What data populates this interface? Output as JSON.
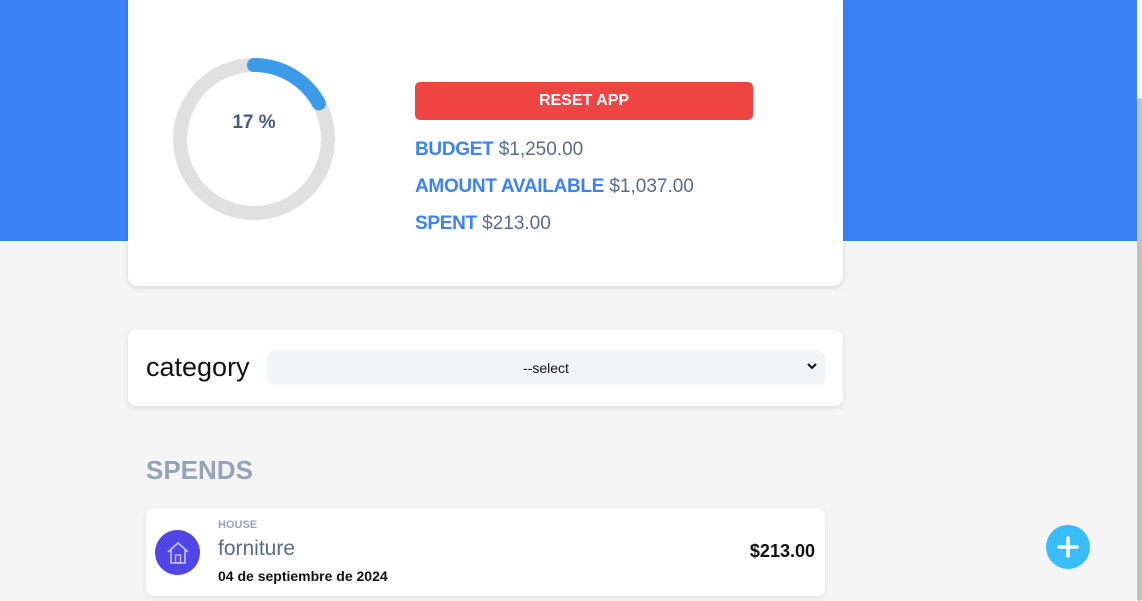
{
  "theme": {
    "accent": "#3b82f6",
    "danger": "#ef4444",
    "progress_track": "#e0e0e0",
    "progress_fill": "#3b9be8",
    "category_icon_bg": "#4f46e5",
    "add_button_bg": "#38bdf8"
  },
  "summary": {
    "progress_percent": 17,
    "progress_label": "17 %",
    "reset_label": "RESET APP",
    "budget": {
      "label": "BUDGET",
      "value": "$1,250.00"
    },
    "available": {
      "label": "AMOUNT AVAILABLE",
      "value": "$1,037.00"
    },
    "spent": {
      "label": "SPENT",
      "value": "$213.00"
    }
  },
  "filter": {
    "label": "category",
    "selected": "--select",
    "chevron_icon": "chevron-down-icon"
  },
  "spends": {
    "title": "SPENDS",
    "items": [
      {
        "category": "HOUSE",
        "name": "forniture",
        "date": "04 de septiembre de 2024",
        "amount": "$213.00",
        "icon": "house-icon"
      }
    ]
  },
  "add_button": {
    "icon": "plus-icon"
  }
}
